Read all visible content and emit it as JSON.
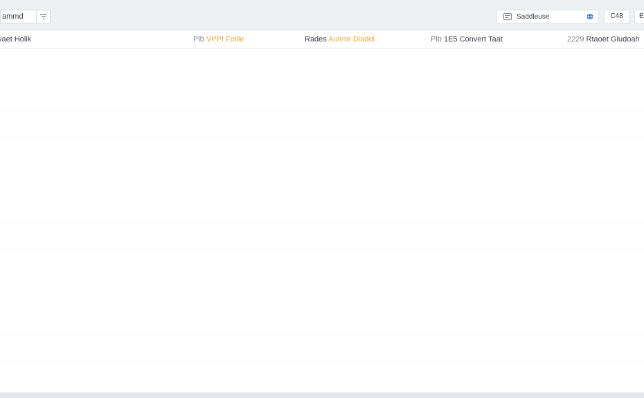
{
  "toolbar": {
    "select_value": "ammd",
    "search_placeholder": "Saddleuse",
    "lang_label": "C48",
    "more_label": "E",
    "icons": {
      "filter": "filter-icon",
      "search_leading": "card-icon",
      "search_trailing": "globe-icon"
    }
  },
  "header": {
    "columns": [
      {
        "prefix": "",
        "label": "yaet Holik"
      },
      {
        "prefix": "Plb",
        "label": "VPPI Folile"
      },
      {
        "prefix": "Rades",
        "label": "Autere Diadol"
      },
      {
        "prefix": "Plb",
        "label": "1E5 Convert Taat"
      },
      {
        "prefix": "2229",
        "label": "Rtaoet Gludoah"
      }
    ]
  },
  "colors": {
    "accent": "#e9a83a",
    "topbar_bg": "#eef0f3",
    "globe": "#2f6fd0"
  }
}
